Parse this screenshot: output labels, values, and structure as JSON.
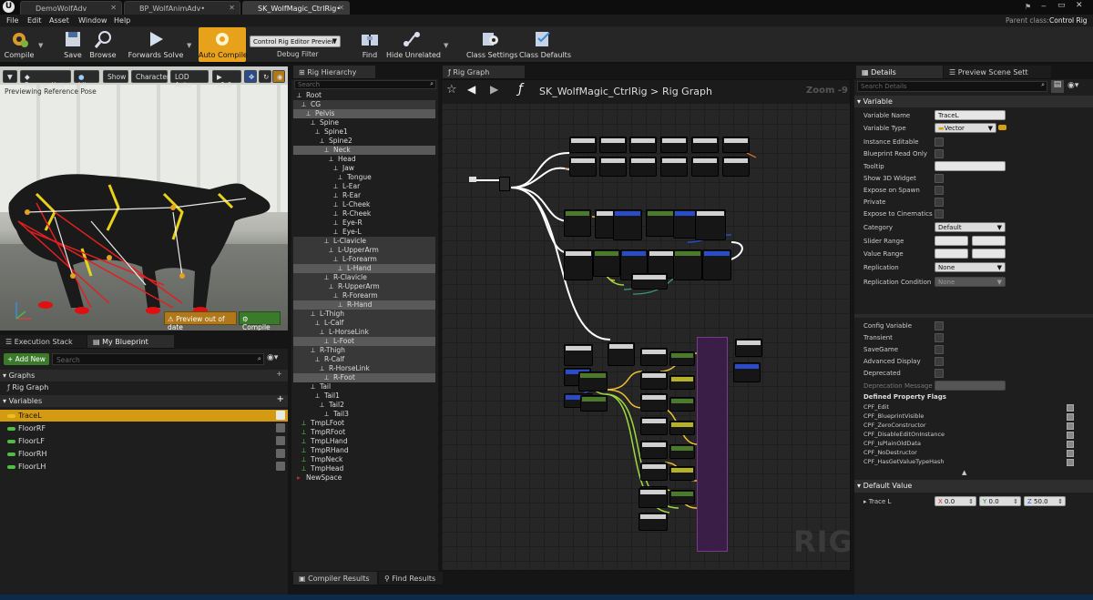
{
  "window": {
    "tabs": [
      {
        "label": "DemoWolfAdv"
      },
      {
        "label": "BP_WolfAnimAdv•"
      },
      {
        "label": "SK_WolfMagic_CtrlRig•"
      }
    ],
    "parent_class_label": "Parent class:",
    "parent_class_value": "Control Rig"
  },
  "menu": {
    "items": [
      "File",
      "Edit",
      "Asset",
      "Window",
      "Help"
    ]
  },
  "toolbar": {
    "compile": "Compile",
    "save": "Save",
    "browse": "Browse",
    "forwards_solve": "Forwards Solve",
    "auto_compile": "Auto Compile",
    "preview_select": "Control Rig Editor Preview",
    "debug_filter": "Debug Filter",
    "find": "Find",
    "hide_unrelated": "Hide Unrelated",
    "class_settings": "Class Settings",
    "class_defaults": "Class Defaults"
  },
  "viewport": {
    "perspective": "Perspective",
    "lit": "Lit",
    "show": "Show",
    "character": "Character",
    "lod": "LOD Auto",
    "speed": "x1.0",
    "previewing": "Previewing Reference Pose",
    "out_of_date": "Preview out of date",
    "compile": "Compile"
  },
  "myblueprint": {
    "tab_execution": "Execution Stack",
    "tab_blueprint": "My Blueprint",
    "add_new": "+ Add New",
    "search_placeholder": "Search",
    "graphs_header": "Graphs",
    "graph_item": "Rig Graph",
    "variables_header": "Variables",
    "variables": [
      "TraceL",
      "FloorRF",
      "FloorLF",
      "FloorRH",
      "FloorLH"
    ]
  },
  "hierarchy": {
    "tab": "Rig Hierarchy",
    "search_placeholder": "Search",
    "items": [
      {
        "label": "Root",
        "depth": 0,
        "hl": false
      },
      {
        "label": "CG",
        "depth": 1,
        "hl": true
      },
      {
        "label": "Pelvis",
        "depth": 2,
        "hl": true
      },
      {
        "label": "Spine",
        "depth": 3,
        "hl": false
      },
      {
        "label": "Spine1",
        "depth": 4,
        "hl": false
      },
      {
        "label": "Spine2",
        "depth": 5,
        "hl": false
      },
      {
        "label": "Neck",
        "depth": 6,
        "hl": true
      },
      {
        "label": "Head",
        "depth": 7,
        "hl": false
      },
      {
        "label": "Jaw",
        "depth": 8,
        "hl": false
      },
      {
        "label": "Tongue",
        "depth": 9,
        "hl": false
      },
      {
        "label": "L-Ear",
        "depth": 8,
        "hl": false
      },
      {
        "label": "R-Ear",
        "depth": 8,
        "hl": false
      },
      {
        "label": "L-Cheek",
        "depth": 8,
        "hl": false
      },
      {
        "label": "R-Cheek",
        "depth": 8,
        "hl": false
      },
      {
        "label": "Eye-R",
        "depth": 8,
        "hl": false
      },
      {
        "label": "Eye-L",
        "depth": 8,
        "hl": false
      },
      {
        "label": "L-Clavicle",
        "depth": 6,
        "hl": true
      },
      {
        "label": "L-UpperArm",
        "depth": 7,
        "hl": true
      },
      {
        "label": "L-Forearm",
        "depth": 8,
        "hl": true
      },
      {
        "label": "L-Hand",
        "depth": 9,
        "hl": true
      },
      {
        "label": "R-Clavicle",
        "depth": 6,
        "hl": true
      },
      {
        "label": "R-UpperArm",
        "depth": 7,
        "hl": true
      },
      {
        "label": "R-Forearm",
        "depth": 8,
        "hl": true
      },
      {
        "label": "R-Hand",
        "depth": 9,
        "hl": true
      },
      {
        "label": "L-Thigh",
        "depth": 3,
        "hl": true
      },
      {
        "label": "L-Calf",
        "depth": 4,
        "hl": true
      },
      {
        "label": "L-HorseLink",
        "depth": 5,
        "hl": true
      },
      {
        "label": "L-Foot",
        "depth": 6,
        "hl": true
      },
      {
        "label": "R-Thigh",
        "depth": 3,
        "hl": true
      },
      {
        "label": "R-Calf",
        "depth": 4,
        "hl": true
      },
      {
        "label": "R-HorseLink",
        "depth": 5,
        "hl": true
      },
      {
        "label": "R-Foot",
        "depth": 6,
        "hl": true
      },
      {
        "label": "Tail",
        "depth": 3,
        "hl": false
      },
      {
        "label": "Tail1",
        "depth": 4,
        "hl": false
      },
      {
        "label": "Tail2",
        "depth": 5,
        "hl": false
      },
      {
        "label": "Tail3",
        "depth": 6,
        "hl": false
      },
      {
        "label": "TmpLFoot",
        "depth": 1,
        "hl": false
      },
      {
        "label": "TmpRFoot",
        "depth": 1,
        "hl": false
      },
      {
        "label": "TmpLHand",
        "depth": 1,
        "hl": false
      },
      {
        "label": "TmpRHand",
        "depth": 1,
        "hl": false
      },
      {
        "label": "TmpNeck",
        "depth": 1,
        "hl": false
      },
      {
        "label": "TmpHead",
        "depth": 1,
        "hl": false
      },
      {
        "label": "NewSpace",
        "depth": 0,
        "hl": false
      }
    ]
  },
  "graph": {
    "tab": "Rig Graph",
    "breadcrumb_asset": "SK_WolfMagic_CtrlRig",
    "breadcrumb_sep": ">",
    "breadcrumb_graph": "Rig Graph",
    "zoom": "Zoom -9",
    "watermark": "RIG"
  },
  "details": {
    "tab_details": "Details",
    "tab_preview": "Preview Scene Sett",
    "search_placeholder": "Search Details",
    "variable_section": "Variable",
    "rows": {
      "variable_name": "Variable Name",
      "variable_name_value": "TraceL",
      "variable_type": "Variable Type",
      "variable_type_value": "Vector",
      "instance_editable": "Instance Editable",
      "blueprint_read_only": "Blueprint Read Only",
      "tooltip": "Tooltip",
      "show_3d_widget": "Show 3D Widget",
      "expose_on_spawn": "Expose on Spawn",
      "private": "Private",
      "expose_to_cinematics": "Expose to Cinematics",
      "category": "Category",
      "category_value": "Default",
      "slider_range": "Slider Range",
      "value_range": "Value Range",
      "replication": "Replication",
      "replication_value": "None",
      "replication_condition": "Replication Condition",
      "replication_condition_value": "None",
      "config_variable": "Config Variable",
      "transient": "Transient",
      "savegame": "SaveGame",
      "advanced_display": "Advanced Display",
      "deprecated": "Deprecated",
      "deprecation_message": "Deprecation Message",
      "defined_flags": "Defined Property Flags"
    },
    "flags": [
      "CPF_Edit",
      "CPF_BlueprintVisible",
      "CPF_ZeroConstructor",
      "CPF_DisableEditOnInstance",
      "CPF_IsPlainOldData",
      "CPF_NoDestructor",
      "CPF_HasGetValueTypeHash"
    ],
    "default_value_section": "Default Value",
    "trace_l": "Trace L",
    "x_label": "X",
    "x_value": "0.0",
    "y_label": "Y",
    "y_value": "0.0",
    "z_label": "Z",
    "z_value": "50.0"
  },
  "bottom": {
    "compiler_results": "Compiler Results",
    "find_results": "Find Results"
  },
  "colors": {
    "accent_orange": "#e8a11a",
    "selected_variable": "#d49a12",
    "graph_bg": "#262626",
    "exec_wire": "#ffffff",
    "vector_pin": "#f0c030",
    "transform_pin": "#2a4cc8",
    "comment_node": "#5a2868"
  }
}
